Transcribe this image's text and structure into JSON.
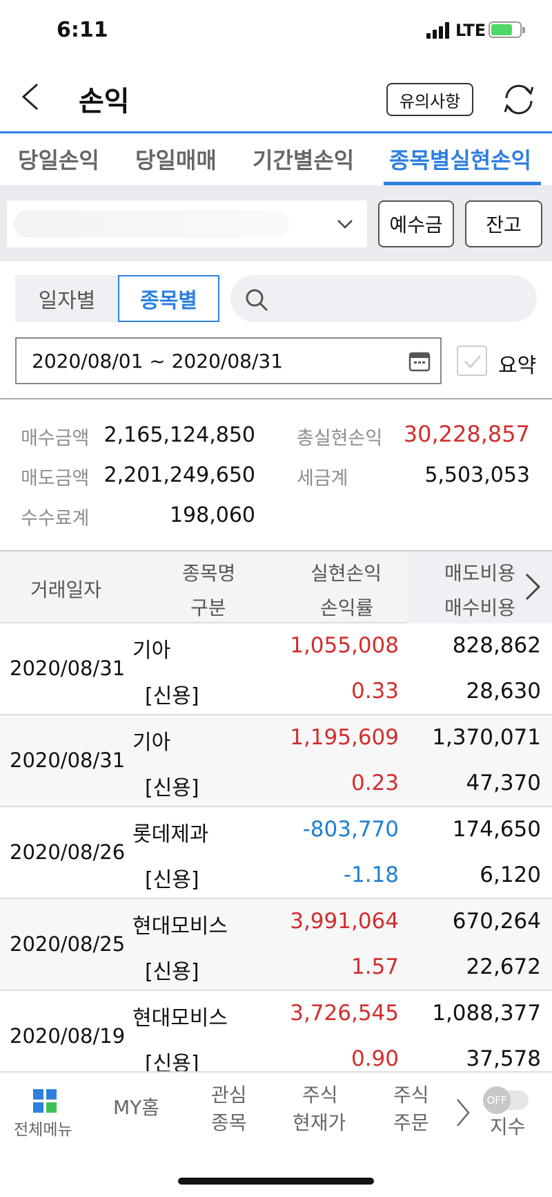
{
  "status_bar": {
    "time": "6:11",
    "network": "LTE"
  },
  "header": {
    "title": "손익",
    "notice_button": "유의사항"
  },
  "tabs": [
    {
      "label": "당일손익"
    },
    {
      "label": "당일매매"
    },
    {
      "label": "기간별손익"
    },
    {
      "label": "종목별실현손익"
    }
  ],
  "account": {
    "deposit_button": "예수금",
    "balance_button": "잔고"
  },
  "filter": {
    "by_date": "일자별",
    "by_item": "종목별",
    "date_range": "2020/08/01 ~ 2020/08/31",
    "summary_label": "요약"
  },
  "summary": {
    "buy_amount_label": "매수금액",
    "buy_amount": "2,165,124,850",
    "sell_amount_label": "매도금액",
    "sell_amount": "2,201,249,650",
    "fee_label": "수수료계",
    "fee": "198,060",
    "total_pl_label": "총실현손익",
    "total_pl": "30,228,857",
    "tax_label": "세금계",
    "tax": "5,503,053"
  },
  "table": {
    "headers": {
      "date": "거래일자",
      "name": "종목명",
      "type": "구분",
      "pl": "실현손익",
      "rate": "손익률",
      "sell_cost": "매도비용",
      "buy_cost": "매수비용"
    },
    "rows": [
      {
        "date": "2020/08/31",
        "name": "기아",
        "type": "[신용]",
        "pl": "1,055,008",
        "rate": "0.33",
        "sell_cost": "828,862",
        "buy_cost": "28,630",
        "sign": "pos"
      },
      {
        "date": "2020/08/31",
        "name": "기아",
        "type": "[신용]",
        "pl": "1,195,609",
        "rate": "0.23",
        "sell_cost": "1,370,071",
        "buy_cost": "47,370",
        "sign": "pos"
      },
      {
        "date": "2020/08/26",
        "name": "롯데제과",
        "type": "[신용]",
        "pl": "-803,770",
        "rate": "-1.18",
        "sell_cost": "174,650",
        "buy_cost": "6,120",
        "sign": "neg"
      },
      {
        "date": "2020/08/25",
        "name": "현대모비스",
        "type": "[신용]",
        "pl": "3,991,064",
        "rate": "1.57",
        "sell_cost": "670,264",
        "buy_cost": "22,672",
        "sign": "pos"
      },
      {
        "date": "2020/08/19",
        "name": "현대모비스",
        "type": "[신용]",
        "pl": "3,726,545",
        "rate": "0.90",
        "sell_cost": "1,088,377",
        "buy_cost": "37,578",
        "sign": "pos"
      }
    ]
  },
  "bottom_nav": {
    "all_menu": "전체메뉴",
    "my_home": "MY홈",
    "watch_1": "관심",
    "watch_2": "종목",
    "price_1": "주식",
    "price_2": "현재가",
    "order_1": "주식",
    "order_2": "주문",
    "toggle": "OFF",
    "index": "지수"
  },
  "colors": {
    "accent": "#2d7fe0",
    "positive": "#d22d2d",
    "negative": "#1f7fd0"
  }
}
